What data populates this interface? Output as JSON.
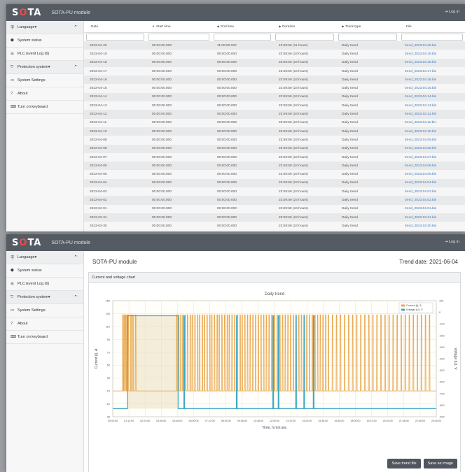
{
  "app": {
    "logo_s": "S",
    "logo_o": "O",
    "logo_ta": "TA",
    "title": "SOTA-PU module",
    "login": "⇥ Log in"
  },
  "sidebar": [
    {
      "icon": "字",
      "label": "Language▾",
      "chevron": "⌃",
      "group": true
    },
    {
      "icon": "⬢",
      "label": "System status"
    },
    {
      "icon": "☰",
      "label": "PLC Event Log (6)"
    },
    {
      "icon": "⛉",
      "label": "Protection system▾",
      "chevron": "⌃",
      "group": true
    },
    {
      "icon": "▭",
      "label": "System Settings"
    },
    {
      "icon": "?",
      "label": "About"
    },
    {
      "icon": "⌨",
      "label": "Turn on keyboard"
    }
  ],
  "table": {
    "columns": [
      {
        "label": "Date",
        "arrow": ""
      },
      {
        "label": "Start time",
        "arrow": "▼"
      },
      {
        "label": "End time",
        "arrow": "◆"
      },
      {
        "label": "Duration",
        "arrow": "◆"
      },
      {
        "label": "Track type",
        "arrow": "◆"
      },
      {
        "label": "File",
        "arrow": ""
      }
    ],
    "rows": [
      [
        "2023-04-20",
        "00:00:00.000",
        "11:00:00.000",
        "10:59:59 (11 hours)",
        "Daily trend",
        "trend_2023.04.20.bin"
      ],
      [
        "2023-04-19",
        "00:00:00.000",
        "00:00:00.000",
        "23:59:59 (24 hours)",
        "Daily trend",
        "trend_2023.04.19.bin"
      ],
      [
        "2023-04-18",
        "00:00:00.000",
        "00:00:00.000",
        "23:59:59 (24 hours)",
        "Daily trend",
        "trend_2023.04.18.bin"
      ],
      [
        "2023-04-17",
        "00:00:00.000",
        "00:00:00.000",
        "23:59:59 (24 hours)",
        "Daily trend",
        "trend_2023.04.17.bin"
      ],
      [
        "2023-04-16",
        "00:00:00.000",
        "00:00:00.000",
        "23:59:59 (24 hours)",
        "Daily trend",
        "trend_2023.04.16.bin"
      ],
      [
        "2023-04-15",
        "00:00:00.000",
        "00:00:00.000",
        "23:59:59 (24 hours)",
        "Daily trend",
        "trend_2023.04.15.bin"
      ],
      [
        "2023-04-14",
        "00:00:00.000",
        "00:00:00.000",
        "23:59:59 (24 hours)",
        "Daily trend",
        "trend_2023.04.14.bin"
      ],
      [
        "2023-04-13",
        "00:00:00.000",
        "00:00:00.000",
        "23:59:59 (24 hours)",
        "Daily trend",
        "trend_2023.04.13.bin"
      ],
      [
        "2023-04-12",
        "00:00:00.000",
        "00:00:00.000",
        "23:59:59 (24 hours)",
        "Daily trend",
        "trend_2023.04.12.bin"
      ],
      [
        "2023-04-11",
        "00:00:00.000",
        "00:00:00.000",
        "23:59:59 (24 hours)",
        "Daily trend",
        "trend_2023.04.11.bin"
      ],
      [
        "2023-04-10",
        "00:00:00.000",
        "00:00:00.000",
        "23:59:59 (24 hours)",
        "Daily trend",
        "trend_2023.04.10.bin"
      ],
      [
        "2023-04-09",
        "00:00:00.000",
        "00:00:00.000",
        "23:59:59 (24 hours)",
        "Daily trend",
        "trend_2023.04.09.bin"
      ],
      [
        "2023-04-08",
        "00:00:00.000",
        "00:00:00.000",
        "23:59:59 (24 hours)",
        "Daily trend",
        "trend_2023.04.08.bin"
      ],
      [
        "2023-04-07",
        "00:00:00.000",
        "00:00:00.000",
        "23:59:59 (24 hours)",
        "Daily trend",
        "trend_2023.04.07.bin"
      ],
      [
        "2023-04-06",
        "00:00:00.000",
        "00:00:00.000",
        "23:59:59 (24 hours)",
        "Daily trend",
        "trend_2023.04.06.bin"
      ],
      [
        "2023-04-05",
        "00:00:00.000",
        "00:00:00.000",
        "23:59:59 (24 hours)",
        "Daily trend",
        "trend_2023.04.05.bin"
      ],
      [
        "2023-04-04",
        "00:00:00.000",
        "00:00:00.000",
        "23:59:59 (24 hours)",
        "Daily trend",
        "trend_2023.04.04.bin"
      ],
      [
        "2023-04-03",
        "00:00:00.000",
        "00:00:00.000",
        "23:59:59 (24 hours)",
        "Daily trend",
        "trend_2023.04.03.bin"
      ],
      [
        "2023-04-02",
        "00:00:00.000",
        "00:00:00.000",
        "23:59:59 (24 hours)",
        "Daily trend",
        "trend_2023.04.02.bin"
      ],
      [
        "2023-04-01",
        "00:00:00.000",
        "00:00:00.000",
        "23:59:59 (24 hours)",
        "Daily trend",
        "trend_2023.04.01.bin"
      ],
      [
        "2023-03-31",
        "00:00:00.000",
        "00:00:00.000",
        "23:59:59 (24 hours)",
        "Daily trend",
        "trend_2023.03.31.bin"
      ],
      [
        "2023-03-30",
        "00:00:00.000",
        "00:00:00.000",
        "23:59:59 (24 hours)",
        "Daily trend",
        "trend_2023.03.30.bin"
      ]
    ]
  },
  "trend": {
    "panel_title": "SOTA-PU module",
    "trend_date": "Trend date: 2021-06-04",
    "caption": "Current and voltage chart",
    "save_trend_label": "Save trend file",
    "save_image_label": "Save as image"
  },
  "chart_data": {
    "type": "line",
    "title": "Daily trend",
    "xlabel": "Time, h:min:sec",
    "ylabel_left": "Current (I), A",
    "ylabel_right": "Voltage (U), V",
    "x_ticks": [
      "00:00:00",
      "01:12:00",
      "02:24:00",
      "03:36:00",
      "04:48:00",
      "06:00:00",
      "07:12:00",
      "08:24:00",
      "09:36:00",
      "10:48:00",
      "12:00:00",
      "13:12:00",
      "14:24:00",
      "15:36:00",
      "16:48:00",
      "18:00:00",
      "19:12:00",
      "20:24:00",
      "21:36:00",
      "22:48:00",
      "24:00:00"
    ],
    "y_left_ticks": [
      "150",
      "130",
      "110",
      "90",
      "70",
      "50",
      "30",
      "10",
      "-10",
      "-30"
    ],
    "y_right_ticks": [
      "100",
      "0",
      "-100",
      "-200",
      "-300",
      "-400",
      "-500",
      "-600",
      "-700",
      "-800",
      "-900"
    ],
    "ylim_left": [
      -30,
      150
    ],
    "ylim_right": [
      -900,
      100
    ],
    "legend_position": "top-right",
    "grid": true,
    "series": [
      {
        "name": "Current (I), A",
        "color": "#e9a64a",
        "baseline": 10,
        "peak": 128,
        "spikes_h": [
          0.75,
          0.85,
          0.95,
          1.05,
          1.15,
          1.35,
          1.5,
          1.7,
          4.75,
          4.9,
          5.05,
          5.2,
          5.4,
          5.55,
          5.75,
          5.9,
          6.1,
          6.3,
          6.45,
          6.65,
          6.8,
          7.0,
          7.2,
          7.35,
          7.55,
          7.75,
          7.9,
          8.1,
          8.3,
          8.5,
          8.65,
          8.85,
          9.05,
          9.25,
          9.45,
          9.6,
          9.8,
          10.0,
          10.2,
          10.4,
          10.6,
          10.8,
          11.0,
          11.2,
          11.4,
          11.6,
          11.8,
          12.0,
          12.2,
          12.4,
          12.6,
          12.8,
          13.0,
          13.2,
          13.4,
          13.6,
          13.8,
          14.0,
          14.2,
          14.4,
          14.6,
          14.8,
          15.0,
          15.2,
          15.4,
          15.6,
          15.8,
          16.0,
          16.3,
          16.6,
          16.9,
          17.2,
          17.5,
          17.8,
          18.1,
          18.4,
          18.7,
          19.0,
          19.3,
          19.6,
          19.9,
          20.2,
          20.5,
          20.8,
          21.1,
          21.4,
          21.7,
          22.0,
          22.3,
          22.6,
          22.9,
          23.2,
          23.5
        ]
      },
      {
        "name": "Voltage (U), V",
        "color": "#3fa9c4",
        "baseline": -830,
        "high_level": -30,
        "high_start_h": 1.1,
        "high_end_h": 4.85,
        "spikes_h": [
          5.3,
          9.2,
          11.9,
          12.3,
          13.6,
          14.2,
          14.9
        ]
      }
    ]
  }
}
